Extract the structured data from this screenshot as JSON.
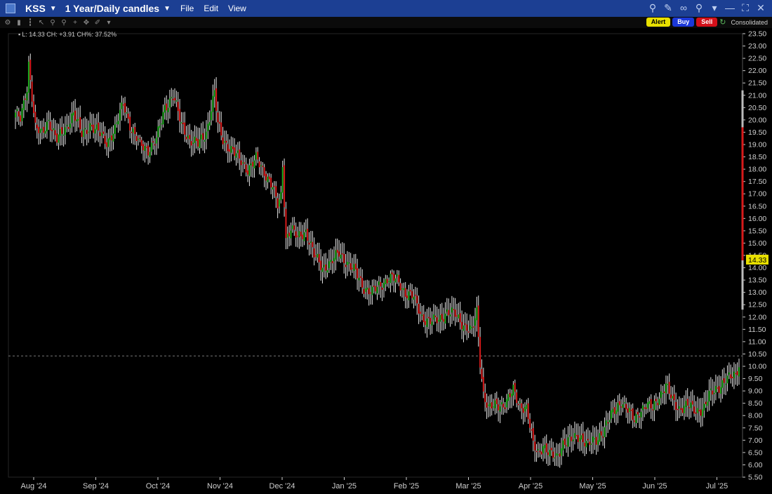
{
  "window": {
    "symbol": "KSS",
    "period": "1 Year/Daily candles",
    "menu": [
      "File",
      "Edit",
      "View"
    ]
  },
  "toolbar": {
    "alert": "Alert",
    "buy": "Buy",
    "sell": "Sell",
    "consolidated": "Consolidated"
  },
  "info": {
    "text": "L: 14.33 CH: +3.91 CH%: 37.52%"
  },
  "colors": {
    "up": "#1faa1f",
    "down": "#d71a1a",
    "axis": "#cfcfcf",
    "priceTag": "#e8e000"
  },
  "chart_data": {
    "type": "candlestick",
    "ylim": [
      5.5,
      23.5
    ],
    "yticks": [
      "23.50",
      "23.00",
      "22.50",
      "22.00",
      "21.50",
      "21.00",
      "20.50",
      "20.00",
      "19.50",
      "19.00",
      "18.50",
      "18.00",
      "17.50",
      "17.00",
      "16.50",
      "16.00",
      "15.50",
      "15.00",
      "14.50",
      "14.00",
      "13.50",
      "13.00",
      "12.50",
      "12.00",
      "11.50",
      "11.00",
      "10.50",
      "10.00",
      "9.50",
      "9.00",
      "8.50",
      "8.00",
      "7.50",
      "7.00",
      "6.50",
      "6.00",
      "5.50"
    ],
    "x_labels": [
      "Aug '24",
      "Sep '24",
      "Oct '24",
      "Nov '24",
      "Dec '24",
      "Jan '25",
      "Feb '25",
      "Mar '25",
      "Apr '25",
      "May '25",
      "Jun '25",
      "Jul '25"
    ],
    "last_price": "14.33",
    "reference_line": 10.42,
    "range_bar": [
      12.3,
      21.2
    ],
    "range_bar_low_segment": [
      14.3,
      19.7
    ],
    "path": [
      [
        0,
        20.3
      ],
      [
        3,
        20.0
      ],
      [
        5,
        20.6
      ],
      [
        7,
        21.3
      ],
      [
        8,
        22.3
      ],
      [
        10,
        21.0
      ],
      [
        12,
        19.7
      ],
      [
        16,
        19.4
      ],
      [
        20,
        20.0
      ],
      [
        25,
        19.2
      ],
      [
        30,
        19.6
      ],
      [
        35,
        20.3
      ],
      [
        40,
        19.4
      ],
      [
        45,
        19.8
      ],
      [
        50,
        19.5
      ],
      [
        55,
        19.1
      ],
      [
        60,
        19.6
      ],
      [
        65,
        20.7
      ],
      [
        70,
        19.6
      ],
      [
        75,
        19.0
      ],
      [
        80,
        18.8
      ],
      [
        85,
        19.2
      ],
      [
        90,
        20.5
      ],
      [
        95,
        21.0
      ],
      [
        100,
        19.8
      ],
      [
        105,
        19.2
      ],
      [
        110,
        19.0
      ],
      [
        115,
        19.5
      ],
      [
        120,
        21.1
      ],
      [
        122,
        19.8
      ],
      [
        125,
        19.2
      ],
      [
        130,
        18.8
      ],
      [
        135,
        18.4
      ],
      [
        140,
        18.0
      ],
      [
        145,
        18.4
      ],
      [
        150,
        17.9
      ],
      [
        155,
        17.3
      ],
      [
        158,
        16.5
      ],
      [
        160,
        16.9
      ],
      [
        161,
        18.2
      ],
      [
        163,
        15.2
      ],
      [
        166,
        15.6
      ],
      [
        170,
        15.2
      ],
      [
        175,
        15.5
      ],
      [
        180,
        14.5
      ],
      [
        185,
        14.0
      ],
      [
        190,
        14.2
      ],
      [
        195,
        14.6
      ],
      [
        200,
        14.2
      ],
      [
        205,
        13.8
      ],
      [
        210,
        13.2
      ],
      [
        215,
        13.0
      ],
      [
        220,
        13.3
      ],
      [
        225,
        13.6
      ],
      [
        230,
        13.5
      ],
      [
        235,
        13.0
      ],
      [
        240,
        12.8
      ],
      [
        245,
        12.0
      ],
      [
        250,
        11.8
      ],
      [
        255,
        11.9
      ],
      [
        260,
        12.2
      ],
      [
        265,
        12.1
      ],
      [
        270,
        11.7
      ],
      [
        275,
        11.4
      ],
      [
        278,
        12.2
      ],
      [
        280,
        10.2
      ],
      [
        282,
        8.9
      ],
      [
        285,
        8.3
      ],
      [
        290,
        8.4
      ],
      [
        295,
        8.5
      ],
      [
        300,
        9.0
      ],
      [
        303,
        8.5
      ],
      [
        308,
        8.3
      ],
      [
        312,
        6.8
      ],
      [
        315,
        6.5
      ],
      [
        318,
        6.8
      ],
      [
        322,
        6.4
      ],
      [
        326,
        6.3
      ],
      [
        330,
        6.9
      ],
      [
        335,
        7.0
      ],
      [
        340,
        7.2
      ],
      [
        345,
        6.8
      ],
      [
        350,
        7.0
      ],
      [
        355,
        7.5
      ],
      [
        360,
        8.1
      ],
      [
        365,
        8.6
      ],
      [
        370,
        8.1
      ],
      [
        373,
        7.8
      ],
      [
        376,
        8.2
      ],
      [
        380,
        8.4
      ],
      [
        384,
        8.3
      ],
      [
        388,
        8.8
      ],
      [
        392,
        9.2
      ],
      [
        396,
        8.6
      ],
      [
        400,
        8.3
      ],
      [
        405,
        8.4
      ],
      [
        410,
        8.2
      ],
      [
        415,
        8.3
      ],
      [
        418,
        8.8
      ],
      [
        422,
        9.1
      ],
      [
        426,
        9.3
      ],
      [
        430,
        9.5
      ],
      [
        434,
        9.7
      ],
      [
        436,
        10.1
      ]
    ]
  }
}
